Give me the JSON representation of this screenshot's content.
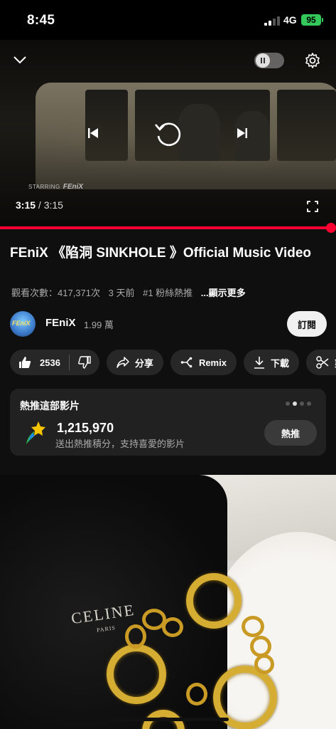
{
  "status_bar": {
    "time": "8:45",
    "network": "4G",
    "battery": "95"
  },
  "player": {
    "starring_label": "STARRING",
    "starring_name": "FEniX",
    "current_time": "3:15",
    "separator": "/",
    "duration": "3:15",
    "progress": 1.0,
    "accent_color": "#ff0033"
  },
  "video": {
    "title": "FEniX 《陷洞 SINKHOLE 》Official Music Video",
    "views": "觀看次數：417,371次",
    "age": "3 天前",
    "trending": "#1 粉絲熱推",
    "more": "...顯示更多"
  },
  "channel": {
    "avatar_text": "FEniX",
    "name": "FEniX",
    "subscribers": "1.99 萬",
    "subscribe_label": "訂閱"
  },
  "actions": {
    "like_count": "2536",
    "share": "分享",
    "remix": "Remix",
    "download": "下載",
    "clip": "剪"
  },
  "hype": {
    "title": "熱推這部影片",
    "count": "1,215,970",
    "subtitle": "送出熱推積分，支持喜愛的影片",
    "button": "熱推",
    "page_dots": 4,
    "active_dot": 1
  },
  "next_thumbnail": {
    "brand": "CELINE",
    "brand_sub": "PARIS"
  },
  "icons": {
    "collapse": "chevron-down-icon",
    "settings": "gear-icon",
    "previous": "skip-previous-icon",
    "replay": "replay-icon",
    "next": "skip-next-icon",
    "fullscreen": "fullscreen-icon",
    "like": "thumb-up-icon",
    "dislike": "thumb-down-icon",
    "share": "share-icon",
    "remix": "remix-icon",
    "download": "download-icon",
    "clip": "scissors-icon",
    "hype": "hype-star-icon"
  }
}
